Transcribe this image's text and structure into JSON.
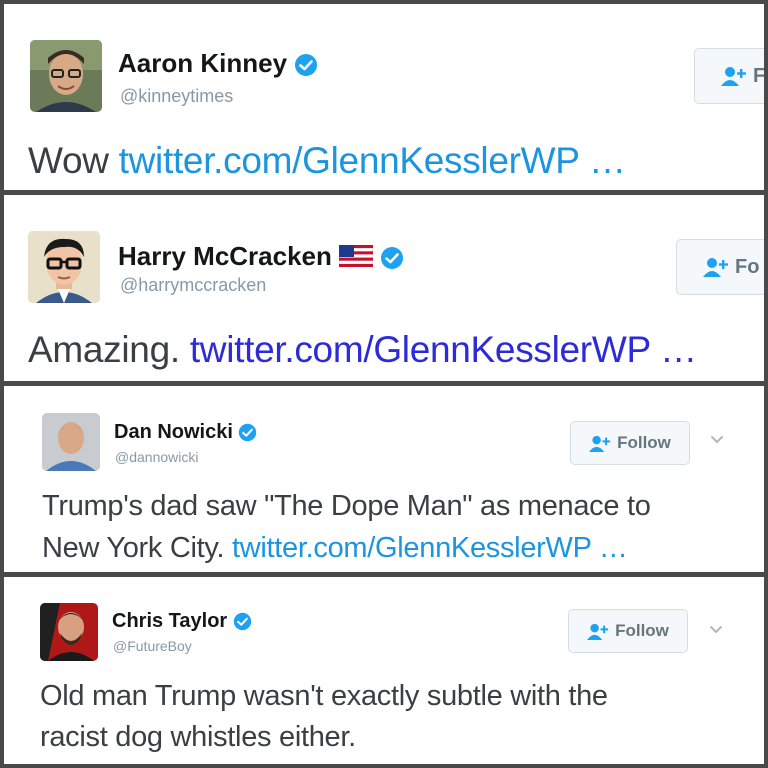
{
  "colors": {
    "divider": "#4a4a4a",
    "name": "#14171a",
    "handle": "#8899a6",
    "link": "#1b95e0",
    "verified": "#1da1f2",
    "follow_bg": "#f5f8fa"
  },
  "tweets": [
    {
      "name": "Aaron Kinney",
      "handle": "@kinneytimes",
      "text": "Wow",
      "link": "twitter.com/GlennKesslerWP …",
      "follow_label": "F",
      "avatar_icon": "avatar-photo"
    },
    {
      "name": "Harry McCracken",
      "handle": "@harrymccracken",
      "text": "Amazing.",
      "link": "twitter.com/GlennKesslerWP …",
      "follow_label": "Fo",
      "avatar_icon": "avatar-cartoon"
    },
    {
      "name": "Dan Nowicki",
      "handle": "@dannowicki",
      "text_line1": "Trump's dad saw \"The Dope Man\" as menace to",
      "text_line2": "New York City.",
      "link": "twitter.com/GlennKesslerWP …",
      "follow_label": "Follow",
      "avatar_icon": "avatar-photo"
    },
    {
      "name": "Chris Taylor",
      "handle": "@FutureBoy",
      "text_line1": "Old man Trump wasn't exactly subtle with the",
      "text_line2": "racist dog whistles either.",
      "follow_label": "Follow",
      "avatar_icon": "avatar-photo"
    }
  ]
}
